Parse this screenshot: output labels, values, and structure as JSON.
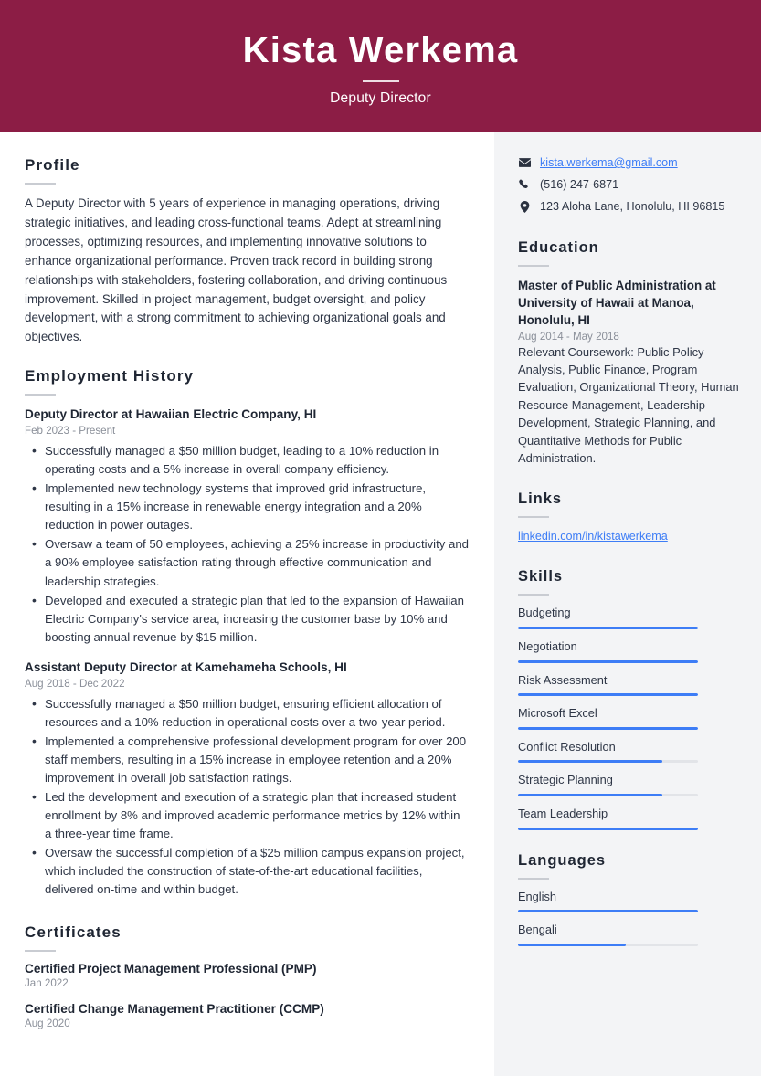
{
  "header": {
    "name": "Kista Werkema",
    "job_title": "Deputy Director",
    "background_color": "#8C1D45"
  },
  "theme": {
    "accent_color": "#3D7DF6",
    "sidebar_background": "#F3F4F6",
    "text_color": "#2E3646"
  },
  "main": {
    "profile": {
      "heading": "Profile",
      "text": "A Deputy Director with 5 years of experience in managing operations, driving strategic initiatives, and leading cross-functional teams. Adept at streamlining processes, optimizing resources, and implementing innovative solutions to enhance organizational performance. Proven track record in building strong relationships with stakeholders, fostering collaboration, and driving continuous improvement. Skilled in project management, budget oversight, and policy development, with a strong commitment to achieving organizational goals and objectives."
    },
    "employment": {
      "heading": "Employment History",
      "jobs": [
        {
          "title": "Deputy Director at Hawaiian Electric Company, HI",
          "date": "Feb 2023 - Present",
          "bullets": [
            "Successfully managed a $50 million budget, leading to a 10% reduction in operating costs and a 5% increase in overall company efficiency.",
            "Implemented new technology systems that improved grid infrastructure, resulting in a 15% increase in renewable energy integration and a 20% reduction in power outages.",
            "Oversaw a team of 50 employees, achieving a 25% increase in productivity and a 90% employee satisfaction rating through effective communication and leadership strategies.",
            "Developed and executed a strategic plan that led to the expansion of Hawaiian Electric Company's service area, increasing the customer base by 10% and boosting annual revenue by $15 million."
          ]
        },
        {
          "title": "Assistant Deputy Director at Kamehameha Schools, HI",
          "date": "Aug 2018 - Dec 2022",
          "bullets": [
            "Successfully managed a $50 million budget, ensuring efficient allocation of resources and a 10% reduction in operational costs over a two-year period.",
            "Implemented a comprehensive professional development program for over 200 staff members, resulting in a 15% increase in employee retention and a 20% improvement in overall job satisfaction ratings.",
            "Led the development and execution of a strategic plan that increased student enrollment by 8% and improved academic performance metrics by 12% within a three-year time frame.",
            "Oversaw the successful completion of a $25 million campus expansion project, which included the construction of state-of-the-art educational facilities, delivered on-time and within budget."
          ]
        }
      ]
    },
    "certificates": {
      "heading": "Certificates",
      "items": [
        {
          "title": "Certified Project Management Professional (PMP)",
          "date": "Jan 2022"
        },
        {
          "title": "Certified Change Management Practitioner (CCMP)",
          "date": "Aug 2020"
        }
      ]
    }
  },
  "sidebar": {
    "contact": [
      {
        "icon": "envelope-icon",
        "text": "kista.werkema@gmail.com",
        "is_link": true
      },
      {
        "icon": "phone-icon",
        "text": "(516) 247-6871",
        "is_link": false
      },
      {
        "icon": "location-pin-icon",
        "text": "123 Aloha Lane, Honolulu, HI 96815",
        "is_link": false
      }
    ],
    "education": {
      "heading": "Education",
      "degree": "Master of Public Administration at University of Hawaii at Manoa, Honolulu, HI",
      "date": "Aug 2014 - May 2018",
      "description": "Relevant Coursework: Public Policy Analysis, Public Finance, Program Evaluation, Organizational Theory, Human Resource Management, Leadership Development, Strategic Planning, and Quantitative Methods for Public Administration."
    },
    "links": {
      "heading": "Links",
      "items": [
        {
          "text": "linkedin.com/in/kistawerkema"
        }
      ]
    },
    "skills": {
      "heading": "Skills",
      "items": [
        {
          "label": "Budgeting",
          "level": 100
        },
        {
          "label": "Negotiation",
          "level": 100
        },
        {
          "label": "Risk Assessment",
          "level": 100
        },
        {
          "label": "Microsoft Excel",
          "level": 100
        },
        {
          "label": "Conflict Resolution",
          "level": 80
        },
        {
          "label": "Strategic Planning",
          "level": 80
        },
        {
          "label": "Team Leadership",
          "level": 100
        }
      ]
    },
    "languages": {
      "heading": "Languages",
      "items": [
        {
          "label": "English",
          "level": 100
        },
        {
          "label": "Bengali",
          "level": 60
        }
      ]
    }
  }
}
